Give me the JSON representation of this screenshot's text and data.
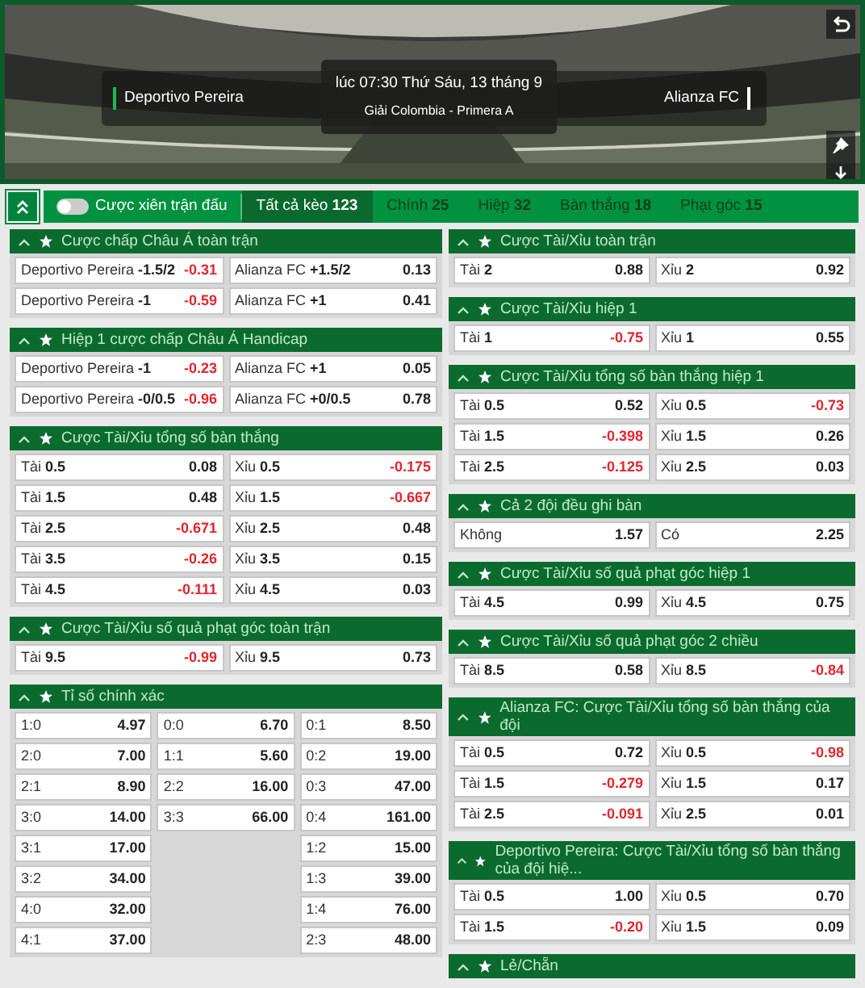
{
  "match": {
    "home": "Deportivo Pereira",
    "time": "lúc 07:30 Thứ Sáu, 13 tháng 9",
    "league": "Giải Colombia - Primera A",
    "away": "Alianza FC"
  },
  "parlay_toggle": {
    "label": "Cược xiên trận đấu",
    "on": false
  },
  "tabs": [
    {
      "label": "Tất cả kèo",
      "count": "123",
      "selected": true
    },
    {
      "label": "Chính",
      "count": "25",
      "selected": false
    },
    {
      "label": "Hiệp",
      "count": "32",
      "selected": false
    },
    {
      "label": "Bàn thắng",
      "count": "18",
      "selected": false
    },
    {
      "label": "Phạt góc",
      "count": "15",
      "selected": false
    }
  ],
  "left_column": [
    {
      "title": "Cược chấp Châu Á toàn trận",
      "kind": "pairs",
      "rows": [
        [
          {
            "label": "Deportivo Pereira",
            "line": "-1.5/2",
            "odds": "-0.31",
            "negative": true
          },
          {
            "label": "Alianza FC",
            "line": "+1.5/2",
            "odds": "0.13",
            "negative": false
          }
        ],
        [
          {
            "label": "Deportivo Pereira",
            "line": "-1",
            "odds": "-0.59",
            "negative": true
          },
          {
            "label": "Alianza FC",
            "line": "+1",
            "odds": "0.41",
            "negative": false
          }
        ]
      ]
    },
    {
      "title": "Hiệp 1 cược chấp Châu Á Handicap",
      "kind": "pairs",
      "rows": [
        [
          {
            "label": "Deportivo Pereira",
            "line": "-1",
            "odds": "-0.23",
            "negative": true
          },
          {
            "label": "Alianza FC",
            "line": "+1",
            "odds": "0.05",
            "negative": false
          }
        ],
        [
          {
            "label": "Deportivo Pereira",
            "line": "-0/0.5",
            "odds": "-0.96",
            "negative": true
          },
          {
            "label": "Alianza FC",
            "line": "+0/0.5",
            "odds": "0.78",
            "negative": false
          }
        ]
      ]
    },
    {
      "title": "Cược Tài/Xỉu tổng số bàn thắng",
      "kind": "pairs",
      "rows": [
        [
          {
            "label": "Tài",
            "line": "0.5",
            "odds": "0.08",
            "negative": false
          },
          {
            "label": "Xỉu",
            "line": "0.5",
            "odds": "-0.175",
            "negative": true
          }
        ],
        [
          {
            "label": "Tài",
            "line": "1.5",
            "odds": "0.48",
            "negative": false
          },
          {
            "label": "Xỉu",
            "line": "1.5",
            "odds": "-0.667",
            "negative": true
          }
        ],
        [
          {
            "label": "Tài",
            "line": "2.5",
            "odds": "-0.671",
            "negative": true
          },
          {
            "label": "Xỉu",
            "line": "2.5",
            "odds": "0.48",
            "negative": false
          }
        ],
        [
          {
            "label": "Tài",
            "line": "3.5",
            "odds": "-0.26",
            "negative": true
          },
          {
            "label": "Xỉu",
            "line": "3.5",
            "odds": "0.15",
            "negative": false
          }
        ],
        [
          {
            "label": "Tài",
            "line": "4.5",
            "odds": "-0.111",
            "negative": true
          },
          {
            "label": "Xỉu",
            "line": "4.5",
            "odds": "0.03",
            "negative": false
          }
        ]
      ]
    },
    {
      "title": "Cược Tài/Xỉu số quả phạt góc toàn trận",
      "kind": "pairs",
      "rows": [
        [
          {
            "label": "Tài",
            "line": "9.5",
            "odds": "-0.99",
            "negative": true
          },
          {
            "label": "Xỉu",
            "line": "9.5",
            "odds": "0.73",
            "negative": false
          }
        ]
      ]
    },
    {
      "title": "Tỉ số chính xác",
      "kind": "scores",
      "columns": [
        [
          {
            "score": "1:0",
            "odds": "4.97"
          },
          {
            "score": "2:0",
            "odds": "7.00"
          },
          {
            "score": "2:1",
            "odds": "8.90"
          },
          {
            "score": "3:0",
            "odds": "14.00"
          },
          {
            "score": "3:1",
            "odds": "17.00"
          },
          {
            "score": "3:2",
            "odds": "34.00"
          },
          {
            "score": "4:0",
            "odds": "32.00"
          },
          {
            "score": "4:1",
            "odds": "37.00"
          }
        ],
        [
          {
            "score": "0:0",
            "odds": "6.70"
          },
          {
            "score": "1:1",
            "odds": "5.60"
          },
          {
            "score": "2:2",
            "odds": "16.00"
          },
          {
            "score": "3:3",
            "odds": "66.00"
          }
        ],
        [
          {
            "score": "0:1",
            "odds": "8.50"
          },
          {
            "score": "0:2",
            "odds": "19.00"
          },
          {
            "score": "0:3",
            "odds": "47.00"
          },
          {
            "score": "0:4",
            "odds": "161.00"
          },
          {
            "score": "1:2",
            "odds": "15.00"
          },
          {
            "score": "1:3",
            "odds": "39.00"
          },
          {
            "score": "1:4",
            "odds": "76.00"
          },
          {
            "score": "2:3",
            "odds": "48.00"
          }
        ]
      ]
    }
  ],
  "right_column": [
    {
      "title": "Cược Tài/Xỉu toàn trận",
      "kind": "pairs",
      "rows": [
        [
          {
            "label": "Tài",
            "line": "2",
            "odds": "0.88",
            "negative": false
          },
          {
            "label": "Xỉu",
            "line": "2",
            "odds": "0.92",
            "negative": false
          }
        ]
      ]
    },
    {
      "title": "Cược Tài/Xỉu hiệp 1",
      "kind": "pairs",
      "rows": [
        [
          {
            "label": "Tài",
            "line": "1",
            "odds": "-0.75",
            "negative": true
          },
          {
            "label": "Xỉu",
            "line": "1",
            "odds": "0.55",
            "negative": false
          }
        ]
      ]
    },
    {
      "title": "Cược Tài/Xỉu tổng số bàn thắng hiệp 1",
      "kind": "pairs",
      "rows": [
        [
          {
            "label": "Tài",
            "line": "0.5",
            "odds": "0.52",
            "negative": false
          },
          {
            "label": "Xỉu",
            "line": "0.5",
            "odds": "-0.73",
            "negative": true
          }
        ],
        [
          {
            "label": "Tài",
            "line": "1.5",
            "odds": "-0.398",
            "negative": true
          },
          {
            "label": "Xỉu",
            "line": "1.5",
            "odds": "0.26",
            "negative": false
          }
        ],
        [
          {
            "label": "Tài",
            "line": "2.5",
            "odds": "-0.125",
            "negative": true
          },
          {
            "label": "Xỉu",
            "line": "2.5",
            "odds": "0.03",
            "negative": false
          }
        ]
      ]
    },
    {
      "title": "Cả 2 đội đều ghi bàn",
      "kind": "pairs",
      "rows": [
        [
          {
            "label": "Không",
            "odds": "1.57",
            "negative": false
          },
          {
            "label": "Có",
            "odds": "2.25",
            "negative": false
          }
        ]
      ]
    },
    {
      "title": "Cược Tài/Xỉu số quả phạt góc hiệp 1",
      "kind": "pairs",
      "rows": [
        [
          {
            "label": "Tài",
            "line": "4.5",
            "odds": "0.99",
            "negative": false
          },
          {
            "label": "Xỉu",
            "line": "4.5",
            "odds": "0.75",
            "negative": false
          }
        ]
      ]
    },
    {
      "title": "Cược Tài/Xỉu số quả phạt góc 2 chiều",
      "kind": "pairs",
      "rows": [
        [
          {
            "label": "Tài",
            "line": "8.5",
            "odds": "0.58",
            "negative": false
          },
          {
            "label": "Xỉu",
            "line": "8.5",
            "odds": "-0.84",
            "negative": true
          }
        ]
      ]
    },
    {
      "title": "Alianza FC: Cược Tài/Xỉu tổng số bàn thắng của đội",
      "kind": "pairs",
      "rows": [
        [
          {
            "label": "Tài",
            "line": "0.5",
            "odds": "0.72",
            "negative": false
          },
          {
            "label": "Xỉu",
            "line": "0.5",
            "odds": "-0.98",
            "negative": true
          }
        ],
        [
          {
            "label": "Tài",
            "line": "1.5",
            "odds": "-0.279",
            "negative": true
          },
          {
            "label": "Xỉu",
            "line": "1.5",
            "odds": "0.17",
            "negative": false
          }
        ],
        [
          {
            "label": "Tài",
            "line": "2.5",
            "odds": "-0.091",
            "negative": true
          },
          {
            "label": "Xỉu",
            "line": "2.5",
            "odds": "0.01",
            "negative": false
          }
        ]
      ]
    },
    {
      "title": "Deportivo Pereira: Cược Tài/Xỉu tổng số bàn thắng của đội hiệ...",
      "kind": "pairs",
      "rows": [
        [
          {
            "label": "Tài",
            "line": "0.5",
            "odds": "1.00",
            "negative": false
          },
          {
            "label": "Xỉu",
            "line": "0.5",
            "odds": "0.70",
            "negative": false
          }
        ],
        [
          {
            "label": "Tài",
            "line": "1.5",
            "odds": "-0.20",
            "negative": true
          },
          {
            "label": "Xỉu",
            "line": "1.5",
            "odds": "0.09",
            "negative": false
          }
        ]
      ]
    },
    {
      "title": "Lẻ/Chẵn",
      "kind": "pairs"
    }
  ]
}
